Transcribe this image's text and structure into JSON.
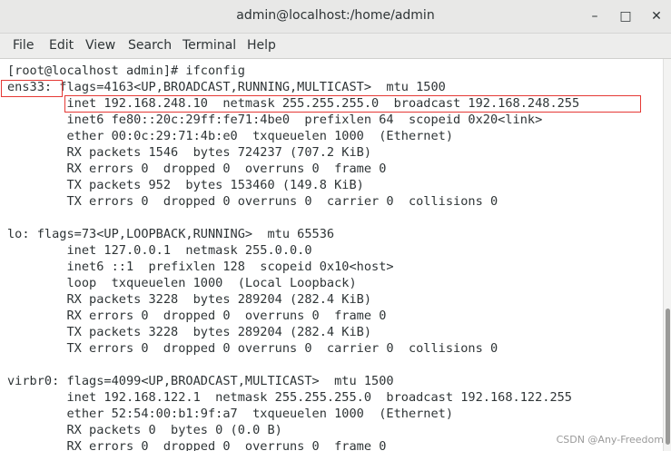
{
  "window": {
    "title": "admin@localhost:/home/admin",
    "controls": {
      "minimize": "–",
      "maximize": "□",
      "close": "✕"
    }
  },
  "menu": [
    "File",
    "Edit",
    "View",
    "Search",
    "Terminal",
    "Help"
  ],
  "terminal": {
    "lines": [
      "[root@localhost admin]# ifconfig",
      "ens33: flags=4163<UP,BROADCAST,RUNNING,MULTICAST>  mtu 1500",
      "        inet 192.168.248.10  netmask 255.255.255.0  broadcast 192.168.248.255",
      "        inet6 fe80::20c:29ff:fe71:4be0  prefixlen 64  scopeid 0x20<link>",
      "        ether 00:0c:29:71:4b:e0  txqueuelen 1000  (Ethernet)",
      "        RX packets 1546  bytes 724237 (707.2 KiB)",
      "        RX errors 0  dropped 0  overruns 0  frame 0",
      "        TX packets 952  bytes 153460 (149.8 KiB)",
      "        TX errors 0  dropped 0 overruns 0  carrier 0  collisions 0",
      "",
      "lo: flags=73<UP,LOOPBACK,RUNNING>  mtu 65536",
      "        inet 127.0.0.1  netmask 255.0.0.0",
      "        inet6 ::1  prefixlen 128  scopeid 0x10<host>",
      "        loop  txqueuelen 1000  (Local Loopback)",
      "        RX packets 3228  bytes 289204 (282.4 KiB)",
      "        RX errors 0  dropped 0  overruns 0  frame 0",
      "        TX packets 3228  bytes 289204 (282.4 KiB)",
      "        TX errors 0  dropped 0 overruns 0  carrier 0  collisions 0",
      "",
      "virbr0: flags=4099<UP,BROADCAST,MULTICAST>  mtu 1500",
      "        inet 192.168.122.1  netmask 255.255.255.0  broadcast 192.168.122.255",
      "        ether 52:54:00:b1:9f:a7  txqueuelen 1000  (Ethernet)",
      "        RX packets 0  bytes 0 (0.0 B)",
      "        RX errors 0  dropped 0  overruns 0  frame 0"
    ]
  },
  "watermark": "CSDN @Any-Freedom",
  "colors": {
    "highlight": "#e53935",
    "text": "#2e3436"
  }
}
